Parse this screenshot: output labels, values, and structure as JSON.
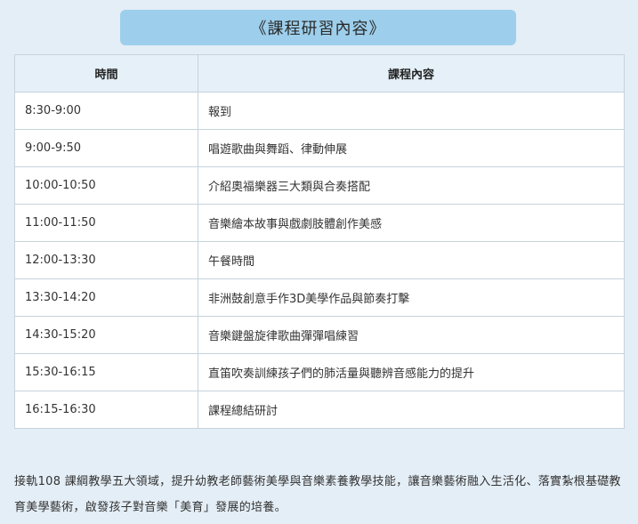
{
  "title": "《課程研習內容》",
  "table": {
    "headers": [
      "時間",
      "課程內容"
    ],
    "rows": [
      {
        "time": "8:30-9:00",
        "content": "報到"
      },
      {
        "time": "9:00-9:50",
        "content": "唱遊歌曲與舞蹈、律動伸展"
      },
      {
        "time": "10:00-10:50",
        "content": "介紹奧福樂器三大類與合奏搭配"
      },
      {
        "time": "11:00-11:50",
        "content": "音樂繪本故事與戲劇肢體創作美感"
      },
      {
        "time": "12:00-13:30",
        "content": "午餐時間"
      },
      {
        "time": "13:30-14:20",
        "content": "非洲鼓創意手作3D美學作品與節奏打擊"
      },
      {
        "time": "14:30-15:20",
        "content": "音樂鍵盤旋律歌曲彈彈唱練習"
      },
      {
        "time": "15:30-16:15",
        "content": "直笛吹奏訓練孩子們的肺活量與聽辨音感能力的提升"
      },
      {
        "time": "16:15-16:30",
        "content": "課程總結研討"
      }
    ]
  },
  "description": "接軌108 課綱教學五大領域，提升幼教老師藝術美學與音樂素養教學技能，讓音樂藝術融入生活化、落實紮根基礎教育美學藝術，啟發孩子對音樂「美育」發展的培養。",
  "colors": {
    "page_background": "#e4eef6",
    "banner_background": "#9dcfec",
    "table_header_background": "#e5f0f8",
    "table_border": "#c6d3dc"
  }
}
